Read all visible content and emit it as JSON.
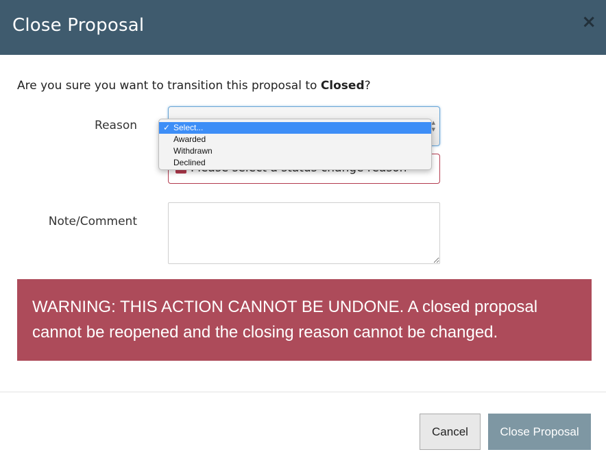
{
  "header": {
    "title": "Close Proposal",
    "close_glyph": "×"
  },
  "question": {
    "prefix": "Are you sure you want to transition this proposal to ",
    "status": "Closed",
    "suffix": "?"
  },
  "form": {
    "reason_label": "Reason",
    "reason_options": [
      "Select...",
      "Awarded",
      "Withdrawn",
      "Declined"
    ],
    "reason_selected": "Select...",
    "reason_error": "Please select a status change reason",
    "note_label": "Note/Comment",
    "note_value": ""
  },
  "warning": {
    "text": "WARNING: THIS ACTION CANNOT BE UNDONE. A closed proposal cannot be reopened and the closing reason cannot be changed."
  },
  "footer": {
    "cancel_label": "Cancel",
    "submit_label": "Close Proposal"
  },
  "colors": {
    "header_bg": "#3f5b6e",
    "warning_bg": "#ad4b5a",
    "error_border": "#b33a4e",
    "dropdown_highlight": "#3d8ef7",
    "submit_bg": "#7e97a3"
  }
}
